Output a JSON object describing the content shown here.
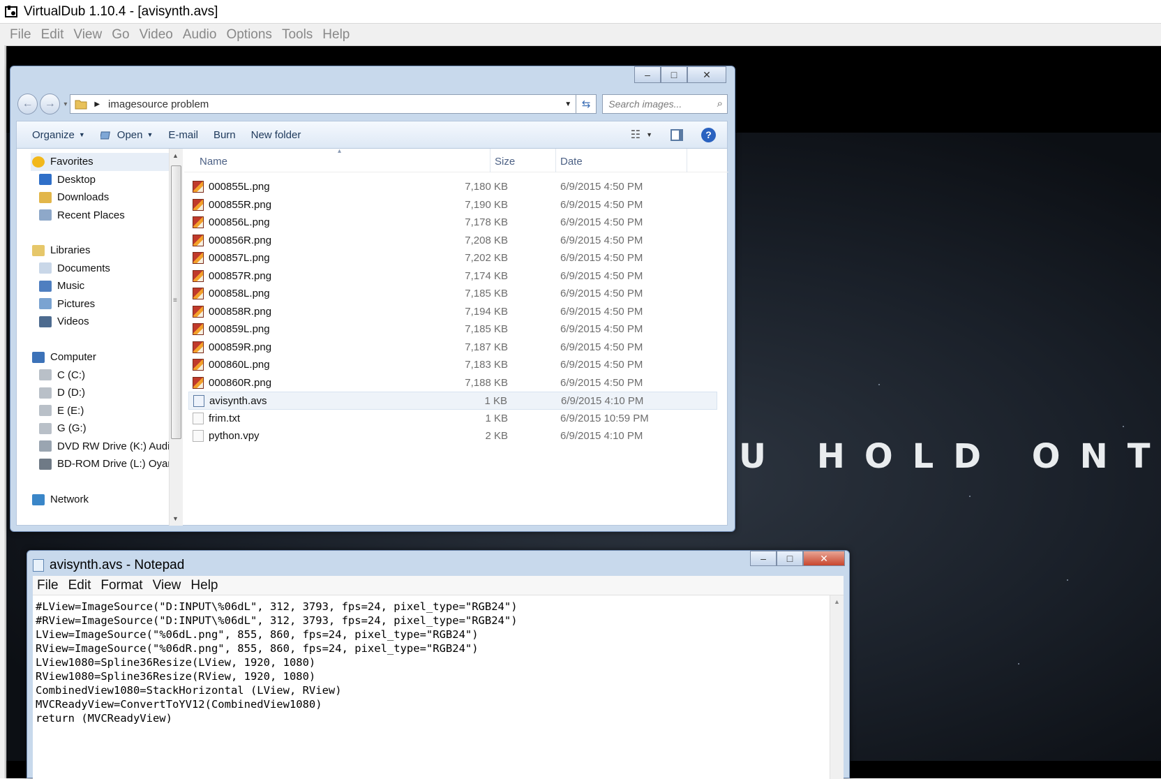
{
  "virtualdub": {
    "title": "VirtualDub 1.10.4 - [avisynth.avs]",
    "menu": [
      "File",
      "Edit",
      "View",
      "Go",
      "Video",
      "Audio",
      "Options",
      "Tools",
      "Help"
    ],
    "video_text": "U HOLD ONTO"
  },
  "explorer": {
    "address": "imagesource problem",
    "search_placeholder": "Search images...",
    "toolbar": {
      "organize": "Organize",
      "open": "Open",
      "email": "E-mail",
      "burn": "Burn",
      "new_folder": "New folder"
    },
    "nav": [
      {
        "label": "Favorites",
        "icon": "star-icon",
        "level": "top"
      },
      {
        "label": "Desktop",
        "icon": "desktop-icon",
        "level": "child"
      },
      {
        "label": "Downloads",
        "icon": "downloads-folder-icon",
        "level": "child"
      },
      {
        "label": "Recent Places",
        "icon": "recent-places-icon",
        "level": "child"
      },
      {
        "label": "Libraries",
        "icon": "libraries-icon",
        "level": "top"
      },
      {
        "label": "Documents",
        "icon": "documents-icon",
        "level": "child"
      },
      {
        "label": "Music",
        "icon": "music-icon",
        "level": "child"
      },
      {
        "label": "Pictures",
        "icon": "pictures-icon",
        "level": "child"
      },
      {
        "label": "Videos",
        "icon": "videos-icon",
        "level": "child"
      },
      {
        "label": "Computer",
        "icon": "computer-icon",
        "level": "top"
      },
      {
        "label": "C (C:)",
        "icon": "drive-icon",
        "level": "child"
      },
      {
        "label": "D (D:)",
        "icon": "drive-icon",
        "level": "child"
      },
      {
        "label": "E (E:)",
        "icon": "drive-icon",
        "level": "child"
      },
      {
        "label": "G (G:)",
        "icon": "drive-icon",
        "level": "child"
      },
      {
        "label": "DVD RW Drive (K:) Audio",
        "icon": "dvd-drive-icon",
        "level": "child"
      },
      {
        "label": "BD-ROM Drive (L:) Oyars",
        "icon": "bd-drive-icon",
        "level": "child"
      },
      {
        "label": "Network",
        "icon": "network-icon",
        "level": "top"
      }
    ],
    "columns": {
      "name": "Name",
      "size": "Size",
      "date": "Date"
    },
    "files": [
      {
        "name": "000855L.png",
        "size": "7,180 KB",
        "date": "6/9/2015 4:50 PM",
        "type": "png"
      },
      {
        "name": "000855R.png",
        "size": "7,190 KB",
        "date": "6/9/2015 4:50 PM",
        "type": "png"
      },
      {
        "name": "000856L.png",
        "size": "7,178 KB",
        "date": "6/9/2015 4:50 PM",
        "type": "png"
      },
      {
        "name": "000856R.png",
        "size": "7,208 KB",
        "date": "6/9/2015 4:50 PM",
        "type": "png"
      },
      {
        "name": "000857L.png",
        "size": "7,202 KB",
        "date": "6/9/2015 4:50 PM",
        "type": "png"
      },
      {
        "name": "000857R.png",
        "size": "7,174 KB",
        "date": "6/9/2015 4:50 PM",
        "type": "png"
      },
      {
        "name": "000858L.png",
        "size": "7,185 KB",
        "date": "6/9/2015 4:50 PM",
        "type": "png"
      },
      {
        "name": "000858R.png",
        "size": "7,194 KB",
        "date": "6/9/2015 4:50 PM",
        "type": "png"
      },
      {
        "name": "000859L.png",
        "size": "7,185 KB",
        "date": "6/9/2015 4:50 PM",
        "type": "png"
      },
      {
        "name": "000859R.png",
        "size": "7,187 KB",
        "date": "6/9/2015 4:50 PM",
        "type": "png"
      },
      {
        "name": "000860L.png",
        "size": "7,183 KB",
        "date": "6/9/2015 4:50 PM",
        "type": "png"
      },
      {
        "name": "000860R.png",
        "size": "7,188 KB",
        "date": "6/9/2015 4:50 PM",
        "type": "png"
      },
      {
        "name": "avisynth.avs",
        "size": "1 KB",
        "date": "6/9/2015 4:10 PM",
        "type": "avs",
        "selected": true
      },
      {
        "name": "frim.txt",
        "size": "1 KB",
        "date": "6/9/2015 10:59 PM",
        "type": "txt"
      },
      {
        "name": "python.vpy",
        "size": "2 KB",
        "date": "6/9/2015 4:10 PM",
        "type": "txt"
      }
    ]
  },
  "notepad": {
    "title": "avisynth.avs - Notepad",
    "menu": [
      "File",
      "Edit",
      "Format",
      "View",
      "Help"
    ],
    "content": "#LView=ImageSource(\"D:INPUT\\%06dL\", 312, 3793, fps=24, pixel_type=\"RGB24\")\n#RView=ImageSource(\"D:INPUT\\%06dL\", 312, 3793, fps=24, pixel_type=\"RGB24\")\nLView=ImageSource(\"%06dL.png\", 855, 860, fps=24, pixel_type=\"RGB24\")\nRView=ImageSource(\"%06dR.png\", 855, 860, fps=24, pixel_type=\"RGB24\")\nLView1080=Spline36Resize(LView, 1920, 1080)\nRView1080=Spline36Resize(RView, 1920, 1080)\nCombinedView1080=StackHorizontal (LView, RView)\nMVCReadyView=ConvertToYV12(CombinedView1080)\nreturn (MVCReadyView)"
  }
}
